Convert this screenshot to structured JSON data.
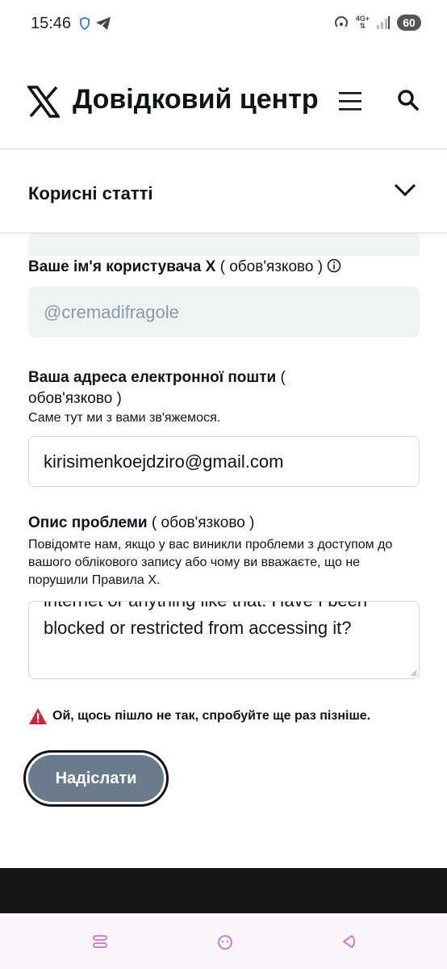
{
  "status_bar": {
    "time": "15:46",
    "network": "4G+",
    "battery": "60"
  },
  "header": {
    "brand_title": "Довідковий центр",
    "icons": [
      "x-logo-icon",
      "menu-icon",
      "search-icon"
    ]
  },
  "articles": {
    "label": "Корисні статті"
  },
  "form": {
    "username": {
      "label": "Ваше ім'я користувача X",
      "required": "( обов'язково )",
      "value": "@cremadifragole"
    },
    "email": {
      "label": "Ваша адреса електронної пошти",
      "required_part1": "(",
      "required_part2": "обов'язково )",
      "hint": "Саме тут ми з вами зв'яжемося.",
      "value": "kirisimenkoejdziro@gmail.com"
    },
    "description": {
      "label": "Опис проблеми",
      "required": "( обов'язково )",
      "hint": "Повідомте нам, якщо у вас виникли проблеми з доступом до вашого облікового запису або чому ви вважаєте, що не порушили Правила X.",
      "value": "internet or anything like that. Have I been blocked or restricted from accessing it?"
    },
    "error": "Ой, щось пішло не так, спробуйте ще раз пізніше.",
    "submit_label": "Надіслати"
  },
  "colors": {
    "accent_button": "#6a7c8b",
    "error_red": "#e0245e",
    "border": "#cfd9de"
  }
}
